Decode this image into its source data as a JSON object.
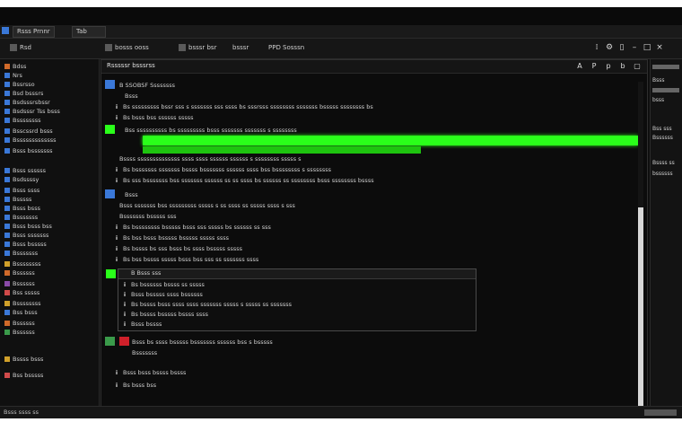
{
  "titlebar": {
    "tabs": [
      {
        "label": "Rsss Prnnr"
      },
      {
        "label": "Tab"
      }
    ]
  },
  "toolbar": {
    "items": [
      {
        "label": "Rsd"
      },
      {
        "label": "bosss ooss"
      },
      {
        "label": "bsssr bsr"
      },
      {
        "label": "bsssr"
      },
      {
        "label": "PPD Sosssn"
      }
    ]
  },
  "sidebar": {
    "items": [
      {
        "label": "Bdss",
        "color": "#d06a2a"
      },
      {
        "label": "Nrs",
        "color": "#3a78d8"
      },
      {
        "label": "Bssrsso",
        "color": "#3a78d8"
      },
      {
        "label": "Bsd bsssrs",
        "color": "#3a78d8"
      },
      {
        "label": "Bsdsssrsbssr",
        "color": "#3a78d8"
      },
      {
        "label": "Bsdsssr Tss bsss",
        "color": "#3a78d8"
      },
      {
        "label": "Bssssssss",
        "color": "#3a78d8"
      },
      {
        "label": "Bsscssrd bsss",
        "color": "#3a78d8"
      },
      {
        "label": "Bsssssssssssss",
        "color": "#3a78d8"
      },
      {
        "label": "Bsss bsssssss",
        "color": "#3a78d8"
      },
      {
        "label": "Bsss ssssss",
        "color": "#3a78d8"
      },
      {
        "label": "Bsdssssy",
        "color": "#3a78d8"
      },
      {
        "label": "Bsss ssss",
        "color": "#3a78d8"
      },
      {
        "label": "Bsssss",
        "color": "#3a78d8"
      },
      {
        "label": "Bsss bsss",
        "color": "#3a78d8"
      },
      {
        "label": "Bsssssss",
        "color": "#3a78d8"
      },
      {
        "label": "Bsss bsss bss",
        "color": "#3a78d8"
      },
      {
        "label": "Bsss sssssss",
        "color": "#3a78d8"
      },
      {
        "label": "Bsss bsssss",
        "color": "#3a78d8"
      },
      {
        "label": "Bsssssss",
        "color": "#3a78d8"
      },
      {
        "label": "Bssssssss",
        "color": "#d0a02a"
      },
      {
        "label": "Bssssss",
        "color": "#d06a2a"
      },
      {
        "label": "Bssssss",
        "color": "#8a4aa8"
      },
      {
        "label": "Bss sssss",
        "color": "#d04a4a"
      },
      {
        "label": "Bssssssss",
        "color": "#d0a02a"
      },
      {
        "label": "Bss bsss",
        "color": "#3a78d8"
      },
      {
        "label": "Bssssss",
        "color": "#d06a2a"
      },
      {
        "label": "Bssssss",
        "color": "#3a9a4a"
      },
      {
        "label": "Bssss bsss",
        "color": "#d0a02a"
      },
      {
        "label": "Bss bsssss",
        "color": "#d04a4a"
      }
    ]
  },
  "main": {
    "title": "Rsssssr bsssrss",
    "header_controls": [
      {
        "label": "A"
      },
      {
        "label": "P"
      },
      {
        "label": "p"
      },
      {
        "label": "b"
      },
      {
        "label": "▢"
      }
    ],
    "rows": [
      {
        "glyph": "",
        "text": "B SSOBSF Ssssssss"
      },
      {
        "glyph": "",
        "text": "Bsss"
      },
      {
        "glyph": "ⅱ",
        "text": "Bs sssssssss bssr sss s sssssss sss ssss bs sssrsss ssssssss sssssss bsssss ssssssss bs"
      },
      {
        "glyph": "ⅱ",
        "text": "Bs bsss bss ssssss sssss"
      },
      {
        "glyph": "",
        "text": "Bss ssssssssss bs sssssssss bsss sssssss sssssss s ssssssss"
      },
      {
        "glyph": "",
        "text": "Bssss ssssssssssssss ssss ssss ssssss ssssss s ssssssss sssss s"
      },
      {
        "glyph": "ⅱ",
        "text": "Bs bsssssss sssssss bssss bsssssss ssssss ssss bss bssssssss s ssssssss"
      },
      {
        "glyph": "ⅱ",
        "text": "Bs sss bsssssss bss sssssss ssssss ss ss ssss bs ssssss ss ssssssss bsss ssssssss bssss"
      },
      {
        "glyph": "ⅱ",
        "text": "Bsss"
      },
      {
        "glyph": "",
        "text": "Bsss sssssss bss sssssssss sssss s ss ssss ss sssss ssss s sss"
      },
      {
        "glyph": "",
        "text": "Bsssssss bsssss sss"
      },
      {
        "glyph": "ⅱ",
        "text": "Bs bssssssss bsssss bsss sss sssss bs ssssss ss sss"
      },
      {
        "glyph": "ⅱ",
        "text": "Bs bss bsss bsssss bsssss sssss ssss"
      },
      {
        "glyph": "ⅱ",
        "text": "Bs bssss bs sss bsss bs ssss bsssss sssss"
      },
      {
        "glyph": "ⅱ",
        "text": "Bs bss bssss sssss bsss bss sss ss sssssss ssss"
      }
    ],
    "box": {
      "title": "B Bsss sss",
      "rows": [
        {
          "glyph": "ⅱ",
          "text": "Bs bssssss bssss ss sssss"
        },
        {
          "glyph": "ⅱ",
          "text": "Bsss bsssss ssss bssssss"
        },
        {
          "glyph": "ⅱ",
          "text": "Bs bssss bsss ssss ssss sssssss sssss s sssss ss sssssss"
        },
        {
          "glyph": "ⅱ",
          "text": "Bs bssss bsssss bssss ssss"
        },
        {
          "glyph": "ⅱ",
          "text": "Bsss bssss"
        }
      ]
    },
    "tail_rows": [
      {
        "glyph": "",
        "text": "Bsss bs ssss bsssss bsssssss ssssss bss s bsssss"
      },
      {
        "glyph": "",
        "text": "Bsssssss"
      },
      {
        "glyph": "ⅱ",
        "text": "Bsss bsss bssss bssss"
      },
      {
        "glyph": "ⅱ",
        "text": "Bs bsss bss"
      }
    ]
  },
  "rpanel": {
    "items": [
      {
        "label": "Bsss"
      },
      {
        "label": "bsss"
      },
      {
        "label": "Bss sss"
      },
      {
        "label": "Bssssss"
      },
      {
        "label": "Bssss ss"
      },
      {
        "label": "bssssss"
      }
    ]
  },
  "statusbar": {
    "text": "Bsss ssss ss"
  },
  "colors": {
    "accent_green": "#2aff1a",
    "accent_blue": "#3a78d8",
    "background": "#0c0c0c"
  }
}
